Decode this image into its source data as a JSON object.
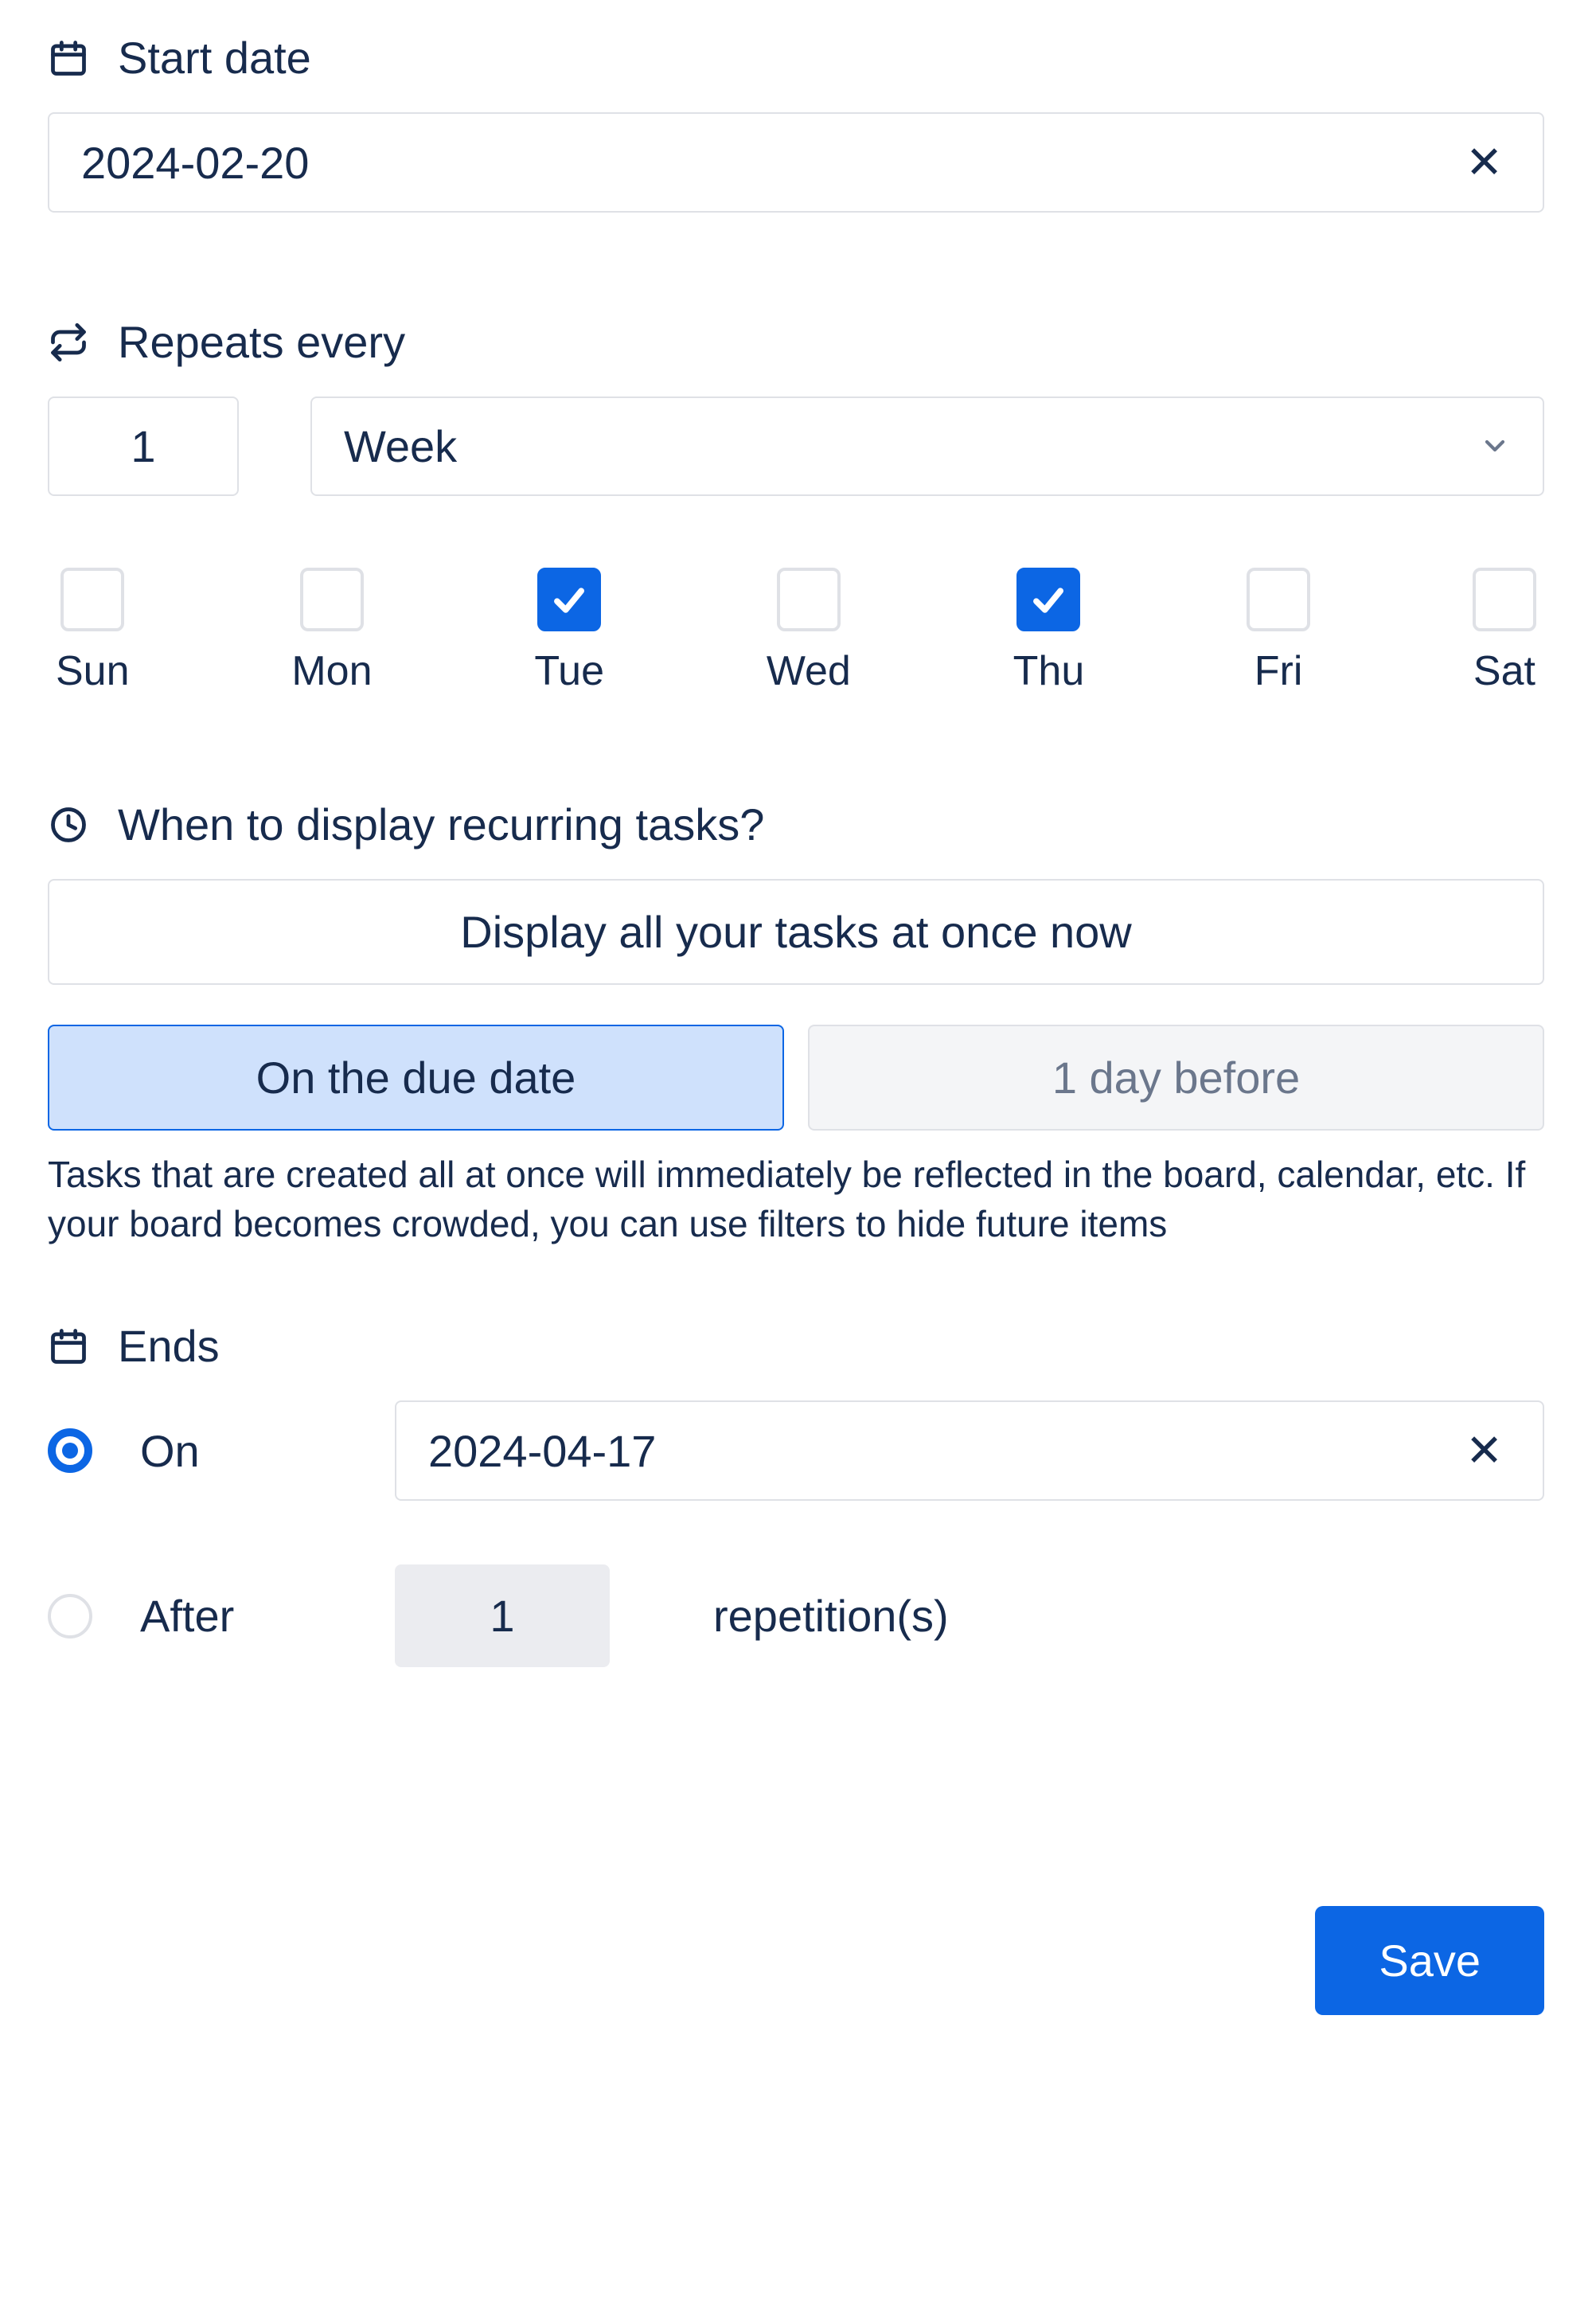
{
  "start": {
    "label": "Start date",
    "value": "2024-02-20"
  },
  "repeats": {
    "label": "Repeats every",
    "count": "1",
    "unit": "Week",
    "days": [
      {
        "abbr": "Sun",
        "checked": false
      },
      {
        "abbr": "Mon",
        "checked": false
      },
      {
        "abbr": "Tue",
        "checked": true
      },
      {
        "abbr": "Wed",
        "checked": false
      },
      {
        "abbr": "Thu",
        "checked": true
      },
      {
        "abbr": "Fri",
        "checked": false
      },
      {
        "abbr": "Sat",
        "checked": false
      }
    ]
  },
  "display": {
    "label": "When to display recurring tasks?",
    "all_at_once": "Display all your tasks at once now",
    "seg_on_due": "On the due date",
    "seg_before": "1 day before",
    "help": "Tasks that are created all at once will immediately be reflected in the board, calendar, etc. If your board becomes crowded, you can use filters to hide future items"
  },
  "ends": {
    "label": "Ends",
    "on_label": "On",
    "on_value": "2024-04-17",
    "after_label": "After",
    "after_count": "1",
    "after_suffix": "repetition(s)"
  },
  "footer": {
    "save": "Save"
  }
}
